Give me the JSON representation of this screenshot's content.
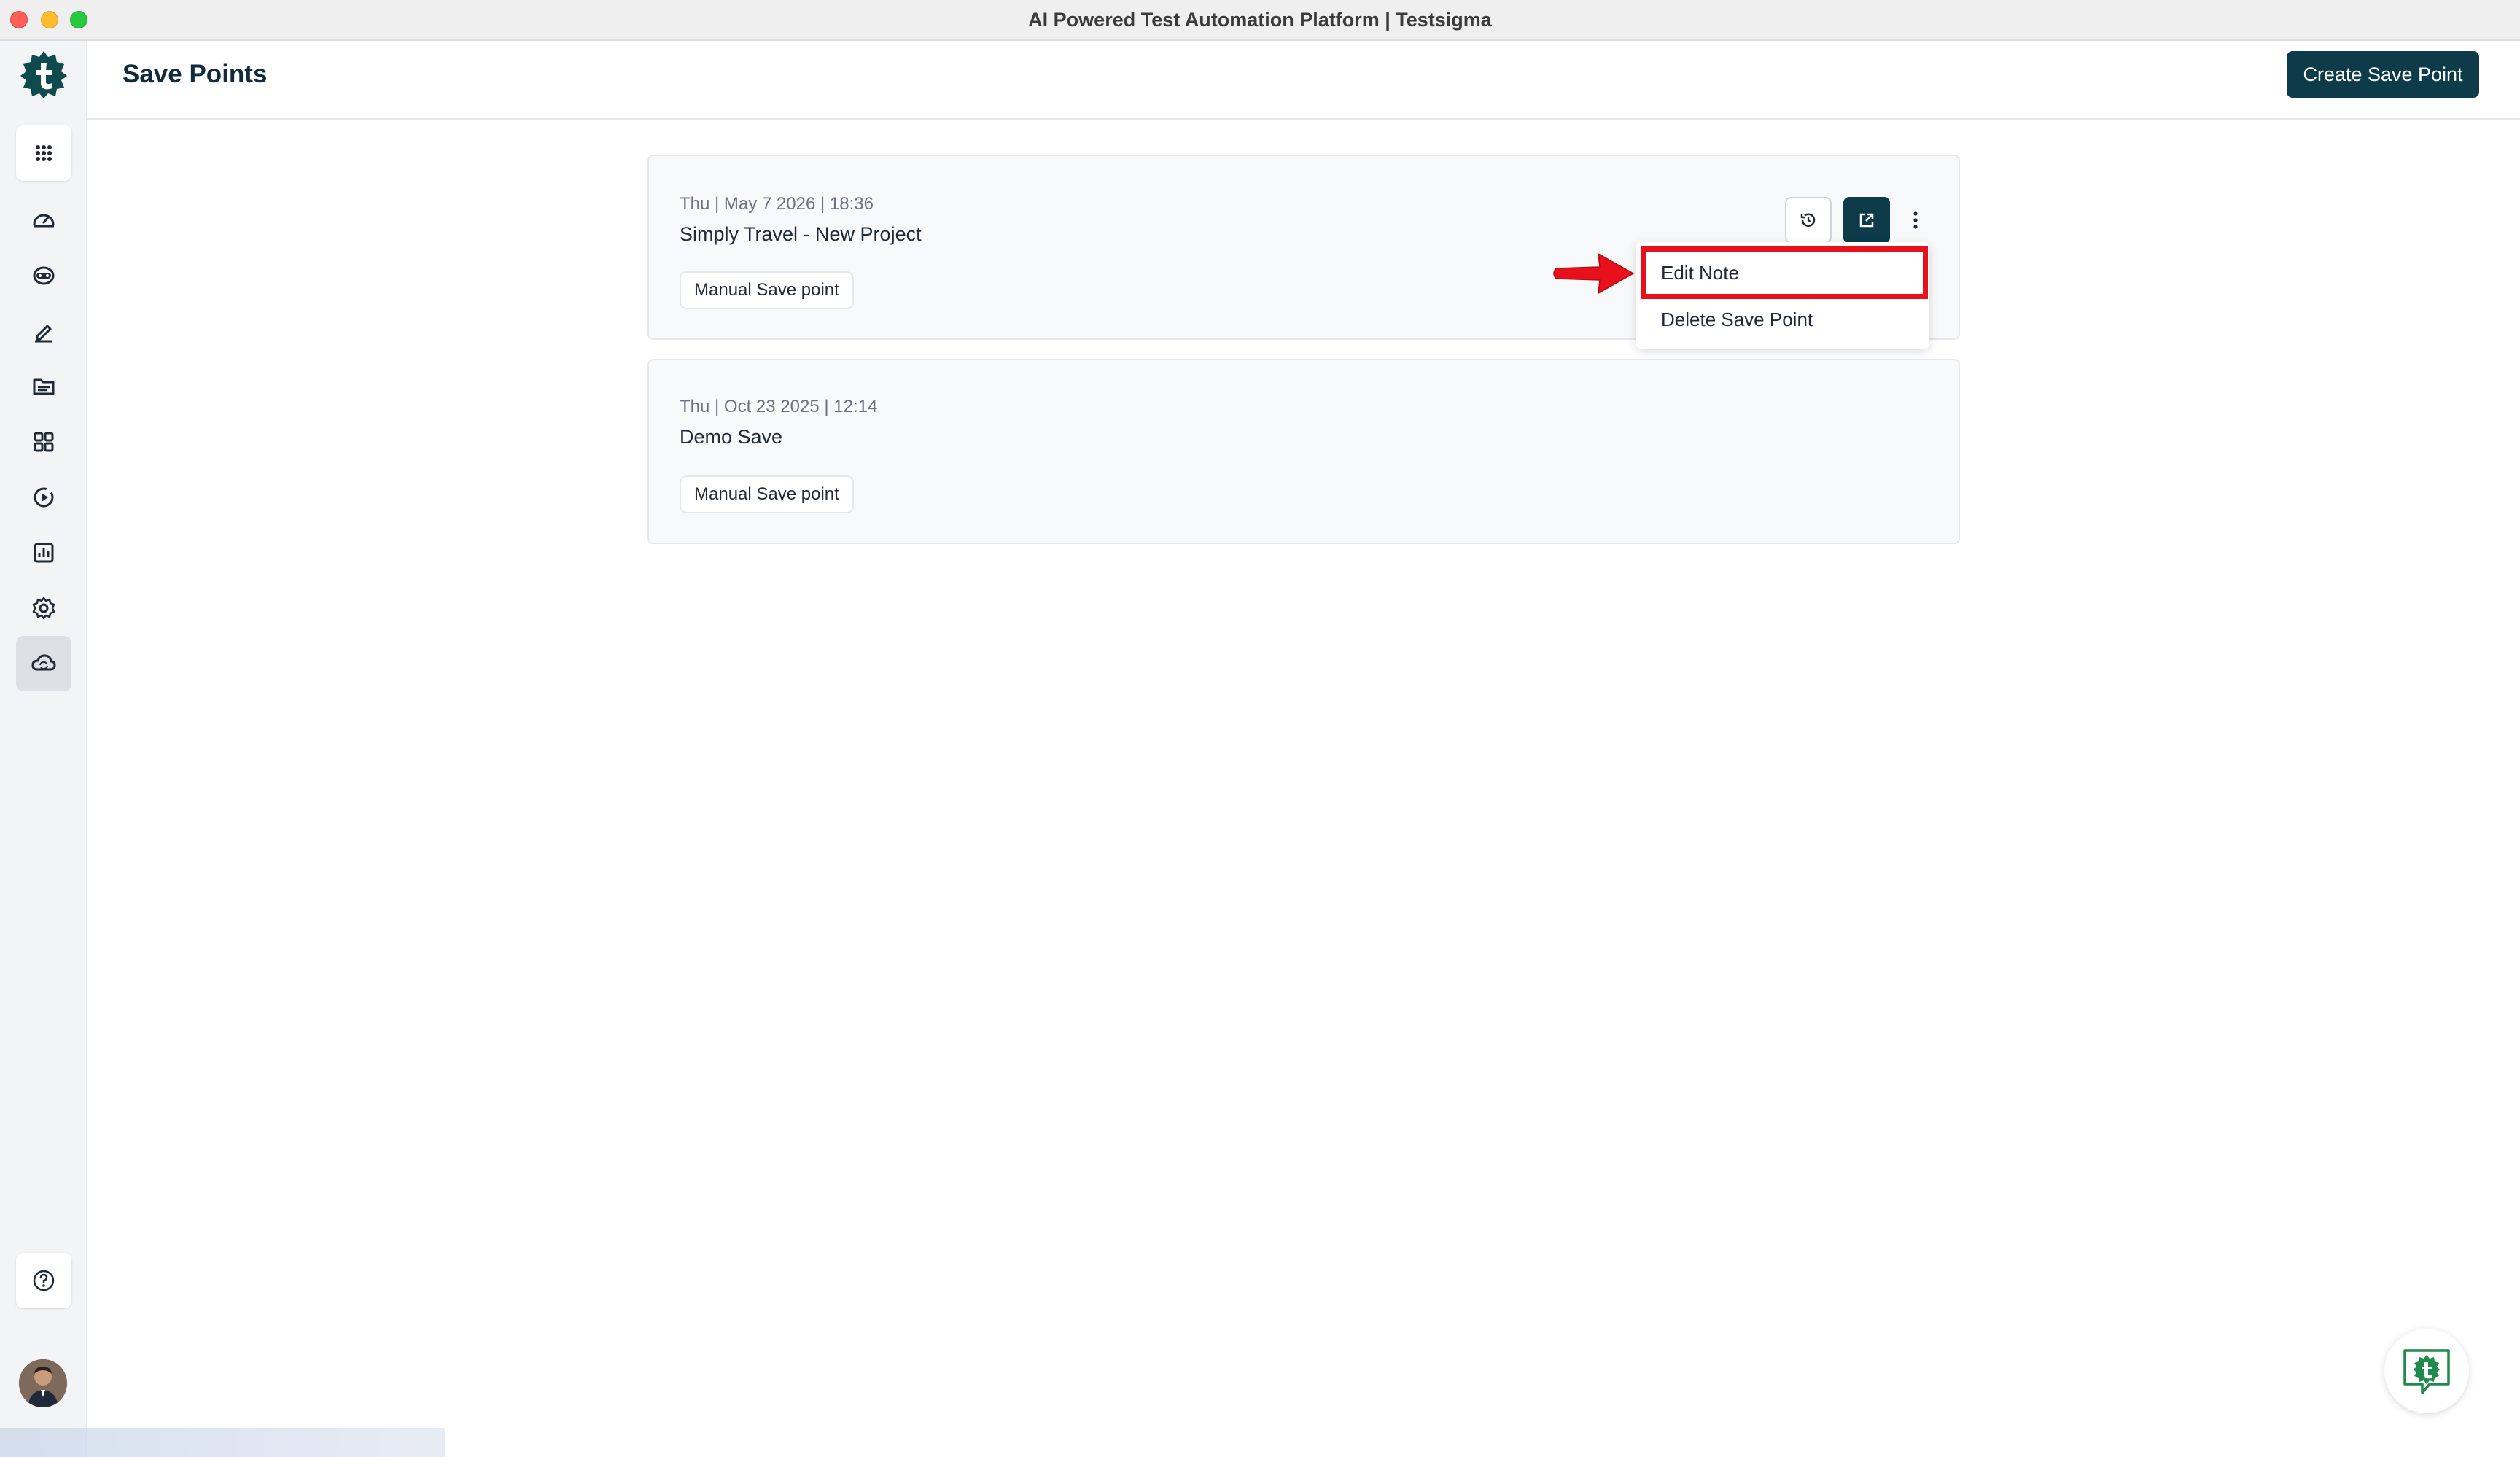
{
  "window": {
    "title": "AI Powered Test Automation Platform | Testsigma"
  },
  "header": {
    "title": "Save Points",
    "create_label": "Create Save Point"
  },
  "sidebar": {
    "items": [
      {
        "icon": "apps-grid-icon"
      },
      {
        "icon": "dashboard-gauge-icon"
      },
      {
        "icon": "ai-agent-icon"
      },
      {
        "icon": "pencil-icon"
      },
      {
        "icon": "folder-icon"
      },
      {
        "icon": "modules-grid-icon"
      },
      {
        "icon": "play-circle-icon"
      },
      {
        "icon": "reports-chart-icon"
      },
      {
        "icon": "settings-gear-icon"
      },
      {
        "icon": "cloud-sync-icon",
        "active": true
      }
    ],
    "help_icon": "help-circle-icon"
  },
  "save_points": [
    {
      "date": "Thu | May 7 2026 | 18:36",
      "name": "Simply Travel - New Project",
      "tag": "Manual Save point"
    },
    {
      "date": "Thu | Oct 23 2025 | 12:14",
      "name": "Demo Save",
      "tag": "Manual Save point"
    }
  ],
  "menu": {
    "edit_label": "Edit Note",
    "delete_label": "Delete Save Point"
  },
  "colors": {
    "primary": "#0d3b4a",
    "annotation": "#e8101a",
    "brand_green": "#1f8a4c"
  }
}
